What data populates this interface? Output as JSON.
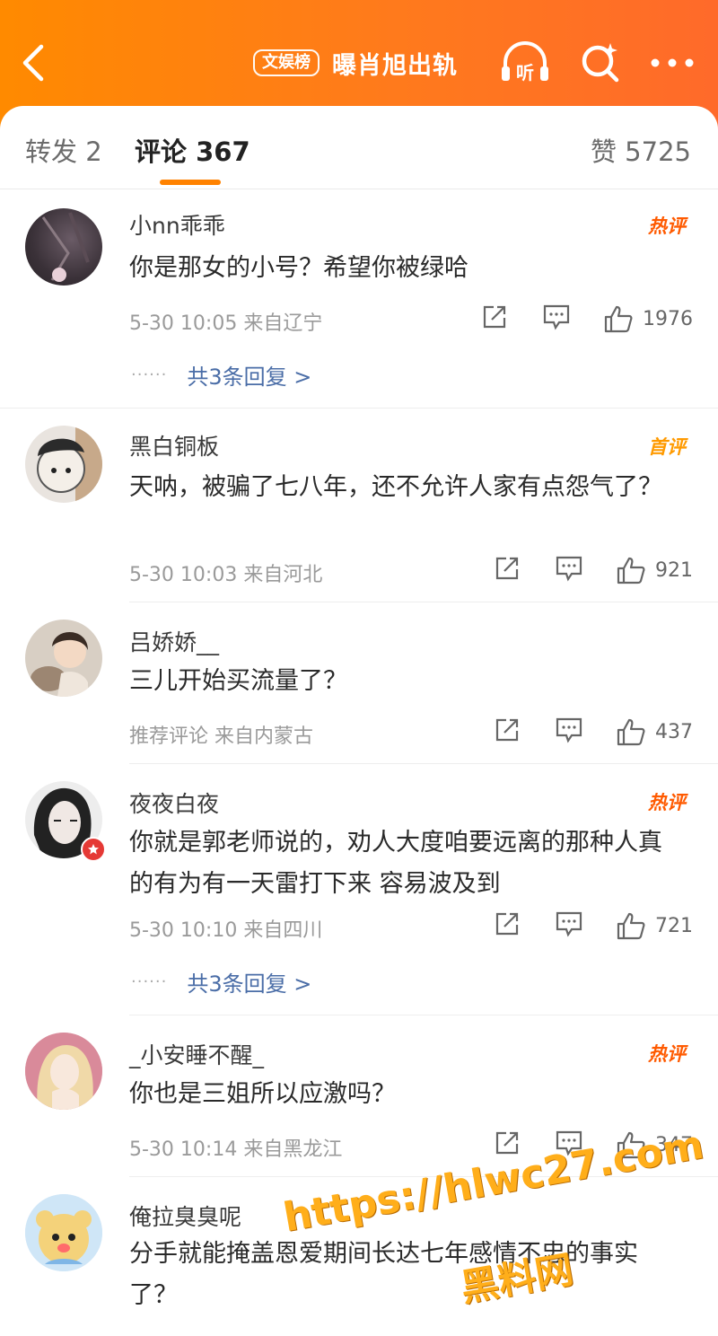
{
  "header": {
    "badge": "文娱榜",
    "title": "曝肖旭出轨",
    "listen_label": "听",
    "colors": {
      "bar": "#ff8200",
      "link": "#4a6da7",
      "hot": "#ff5a00",
      "first": "#ff9a00"
    }
  },
  "tabs": {
    "forward": "转发 2",
    "comments": "评论 367",
    "likes": "赞 5725"
  },
  "comments": [
    {
      "user": "小nn乖乖",
      "tag": "热评",
      "text": "你是那女的小号？希望你被绿哈",
      "meta": "5-30 10:05 来自辽宁",
      "likes": "1976",
      "replies": "共3条回复 >"
    },
    {
      "user": "黑白铜板",
      "tag": "首评",
      "text": "天呐，被骗了七八年，还不允许人家有点怨气了？",
      "meta": "5-30 10:03 来自河北",
      "likes": "921"
    },
    {
      "user": "吕娇娇__",
      "tag": "",
      "text": "三儿开始买流量了？",
      "meta": "推荐评论 来自内蒙古",
      "likes": "437"
    },
    {
      "user": "夜夜白夜",
      "tag": "热评",
      "text": "你就是郭老师说的，劝人大度咱要远离的那种人真的有为有一天雷打下来 容易波及到",
      "meta": "5-30 10:10 来自四川",
      "likes": "721",
      "replies": "共3条回复 >"
    },
    {
      "user": "_小安睡不醒_",
      "tag": "热评",
      "text": "你也是三姐所以应激吗？",
      "meta": "5-30 10:14 来自黑龙江",
      "likes": "347"
    },
    {
      "user": "俺拉臭臭呢",
      "tag": "",
      "text": "分手就能掩盖恩爱期间长达七年感情不忠的事实了？",
      "meta": "",
      "likes": ""
    }
  ],
  "watermark": {
    "url": "https://hlwc27.com",
    "site": "黑料网"
  }
}
